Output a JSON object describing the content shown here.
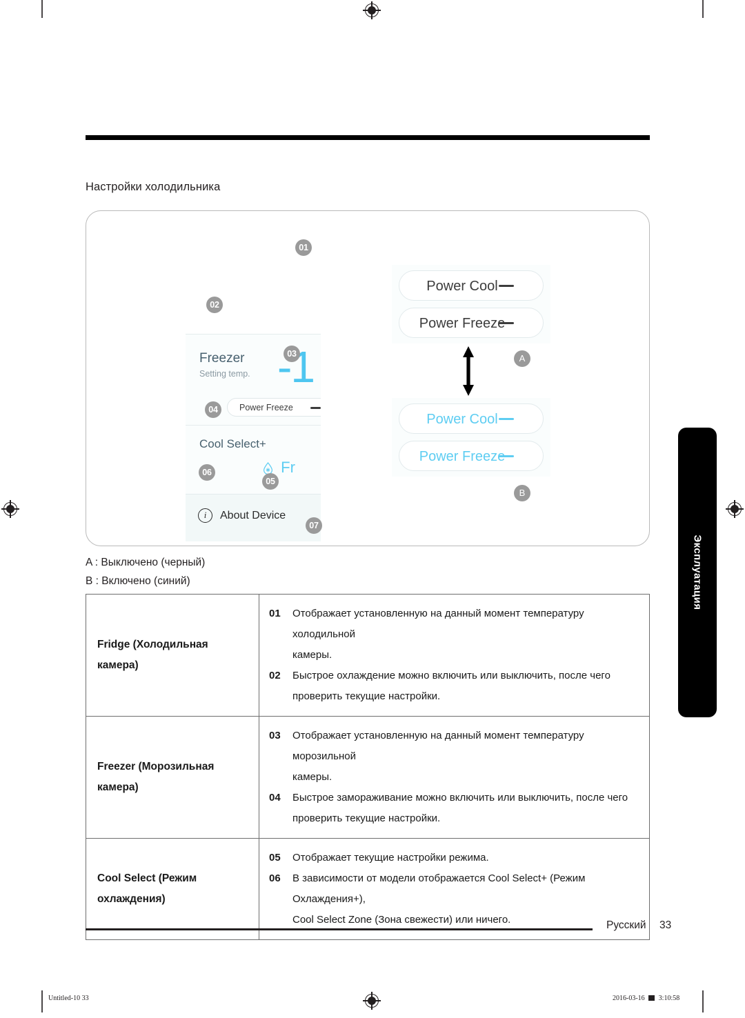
{
  "page": {
    "section_caption": "Настройки холодильника",
    "side_tab_label": "Эксплуатация",
    "footer_language": "Русский",
    "footer_page_number": "33",
    "slug_left": "Untitled-10   33",
    "slug_right_date": "2016-03-16",
    "slug_right_time": "3:10:58"
  },
  "illustration": {
    "app_card": {
      "freezer_title": "Freezer",
      "freezer_subtitle": "Setting temp.",
      "freezer_temp": "-1",
      "power_freeze_pill": "Power Freeze",
      "cool_select_title": "Cool Select+",
      "fresh_label": "Fr",
      "about_device_label": "About Device",
      "info_icon_glyph": "i"
    },
    "toggle_group_a": {
      "state": "off",
      "state_color": "#3c3c3c",
      "pills": [
        {
          "label": "Power Cool"
        },
        {
          "label": "Power Freeze"
        }
      ]
    },
    "toggle_group_b": {
      "state": "on",
      "state_color": "#5ecdf2",
      "pills": [
        {
          "label": "Power Cool"
        },
        {
          "label": "Power Freeze"
        }
      ]
    },
    "badges": [
      {
        "id": "01",
        "label": "01"
      },
      {
        "id": "02",
        "label": "02"
      },
      {
        "id": "03",
        "label": "03"
      },
      {
        "id": "04",
        "label": "04"
      },
      {
        "id": "05",
        "label": "05"
      },
      {
        "id": "06",
        "label": "06"
      },
      {
        "id": "07",
        "label": "07"
      }
    ],
    "letter_badges": [
      {
        "id": "A",
        "label": "A"
      },
      {
        "id": "B",
        "label": "B"
      }
    ]
  },
  "legend": {
    "line_a": "A : Выключено (черный)",
    "line_b": "B : Включено (синий)"
  },
  "table": {
    "rows": [
      {
        "label_line1": "Fridge (Холодильная",
        "label_line2": "камера)",
        "items": [
          {
            "num": "01",
            "line1": "Отображает установленную на данный момент температуру холодильной",
            "line2": "камеры."
          },
          {
            "num": "02",
            "line1": "Быстрое охлаждение можно включить или выключить, после чего",
            "line2": "проверить текущие настройки."
          }
        ]
      },
      {
        "label_line1": "Freezer (Морозильная",
        "label_line2": "камера)",
        "items": [
          {
            "num": "03",
            "line1": "Отображает установленную на данный момент температуру морозильной",
            "line2": "камеры."
          },
          {
            "num": "04",
            "line1": "Быстрое замораживание можно включить или выключить, после чего",
            "line2": "проверить текущие настройки."
          }
        ]
      },
      {
        "label_line1": "Cool Select (Режим",
        "label_line2": "охлаждения)",
        "items": [
          {
            "num": "05",
            "line1": "Отображает текущие настройки режима.",
            "line2": ""
          },
          {
            "num": "06",
            "line1": "В зависимости от модели отображается Cool Select+ (Режим Охлаждения+),",
            "line2": "Cool Select Zone (Зона свежести) или ничего."
          }
        ]
      }
    ]
  }
}
